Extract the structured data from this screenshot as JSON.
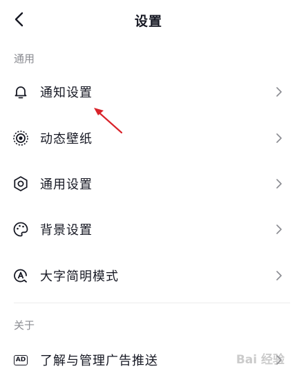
{
  "header": {
    "title": "设置",
    "back_icon": "chevron-left-icon"
  },
  "sections": [
    {
      "title": "通用",
      "items": [
        {
          "label": "通知设置",
          "icon": "bell-icon"
        },
        {
          "label": "动态壁纸",
          "icon": "live-wallpaper-icon"
        },
        {
          "label": "通用设置",
          "icon": "gear-icon"
        },
        {
          "label": "背景设置",
          "icon": "palette-icon"
        },
        {
          "label": "大字简明模式",
          "icon": "large-text-mode-icon"
        }
      ]
    },
    {
      "title": "关于",
      "items": [
        {
          "label": "了解与管理广告推送",
          "icon": "ad-icon",
          "icon_text": "AD"
        }
      ]
    }
  ],
  "annotation": {
    "arrow_color": "#d9232a"
  },
  "watermark": {
    "text": "Bai 经验"
  }
}
